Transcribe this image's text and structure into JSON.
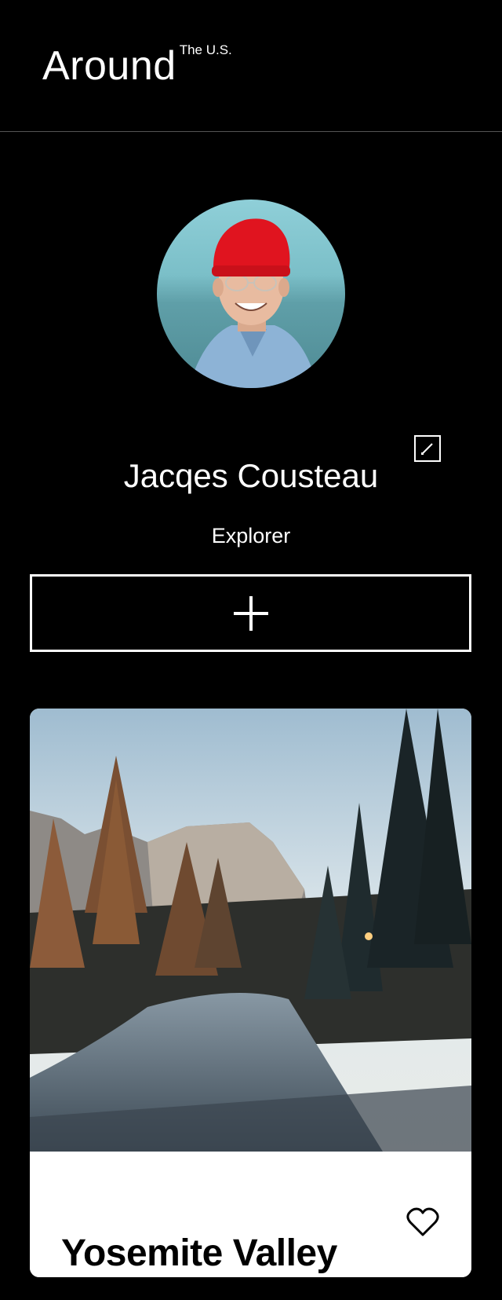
{
  "header": {
    "logo_main": "Around",
    "logo_sup": "The U.S."
  },
  "profile": {
    "name": "Jacqes Cousteau",
    "about": "Explorer",
    "avatar_icon": "avatar-photo",
    "edit_icon": "pencil-icon"
  },
  "add_button": {
    "icon": "plus-icon"
  },
  "cards": [
    {
      "title": "Yosemite Valley",
      "image_icon": "landscape-photo",
      "like_icon": "heart-icon",
      "liked": false
    }
  ],
  "colors": {
    "background": "#000000",
    "text": "#ffffff",
    "card_bg": "#ffffff",
    "card_text": "#000000",
    "divider": "#545454"
  }
}
